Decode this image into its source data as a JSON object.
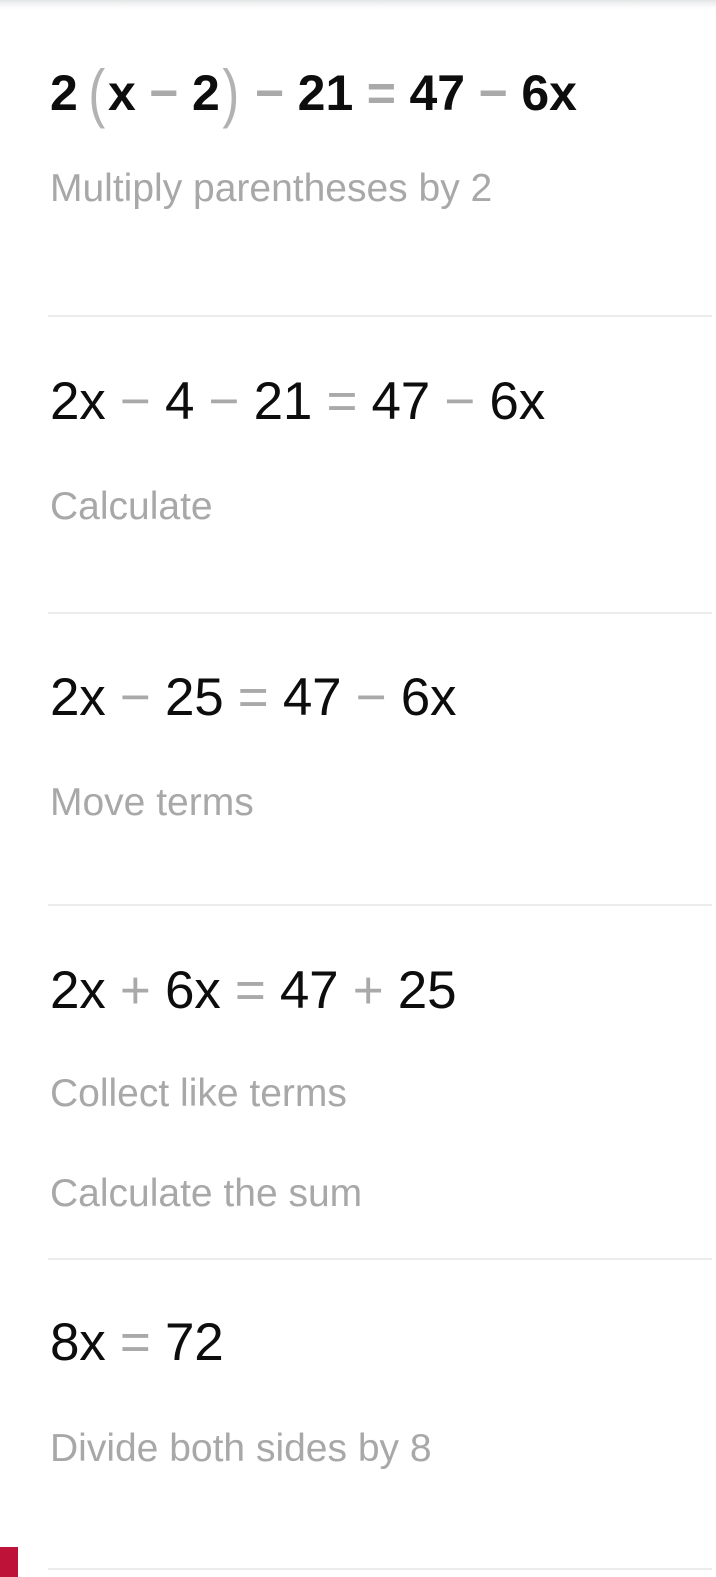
{
  "app": {
    "kind": "math-solver-steps",
    "colors": {
      "text": "#0d0d0d",
      "muted": "#a8a8a8",
      "operator": "#a9a9a9",
      "paren": "#b2b2b2",
      "divider": "#ececec",
      "accent": "#be1238",
      "background": "#ffffff"
    }
  },
  "problem": {
    "original_equation": "2(x − 2) − 21 = 47 − 6x",
    "variable": "x"
  },
  "steps": [
    {
      "index": 1,
      "equation_text": "2(x − 2) − 21 = 47 − 6x",
      "emphasis": "bold",
      "tokens": [
        {
          "t": "2",
          "k": "term"
        },
        {
          "t": "(",
          "k": "paren"
        },
        {
          "t": "x",
          "k": "term"
        },
        {
          "t": "−",
          "k": "op"
        },
        {
          "t": "2",
          "k": "term"
        },
        {
          "t": ")",
          "k": "paren"
        },
        {
          "t": "−",
          "k": "op"
        },
        {
          "t": "21",
          "k": "term"
        },
        {
          "t": "=",
          "k": "op"
        },
        {
          "t": "47",
          "k": "term"
        },
        {
          "t": "−",
          "k": "op"
        },
        {
          "t": "6x",
          "k": "term"
        }
      ],
      "hints": [
        "Multiply parentheses by 2"
      ]
    },
    {
      "index": 2,
      "equation_text": "2x − 4 − 21 = 47 − 6x",
      "emphasis": "regular",
      "tokens": [
        {
          "t": "2x",
          "k": "term"
        },
        {
          "t": "−",
          "k": "op"
        },
        {
          "t": "4",
          "k": "term"
        },
        {
          "t": "−",
          "k": "op"
        },
        {
          "t": "21",
          "k": "term"
        },
        {
          "t": "=",
          "k": "op"
        },
        {
          "t": "47",
          "k": "term"
        },
        {
          "t": "−",
          "k": "op"
        },
        {
          "t": "6x",
          "k": "term"
        }
      ],
      "hints": [
        "Calculate"
      ]
    },
    {
      "index": 3,
      "equation_text": "2x − 25 = 47 − 6x",
      "emphasis": "regular",
      "tokens": [
        {
          "t": "2x",
          "k": "term"
        },
        {
          "t": "−",
          "k": "op"
        },
        {
          "t": "25",
          "k": "term"
        },
        {
          "t": "=",
          "k": "op"
        },
        {
          "t": "47",
          "k": "term"
        },
        {
          "t": "−",
          "k": "op"
        },
        {
          "t": "6x",
          "k": "term"
        }
      ],
      "hints": [
        "Move terms"
      ]
    },
    {
      "index": 4,
      "equation_text": "2x + 6x = 47 + 25",
      "emphasis": "regular",
      "tokens": [
        {
          "t": "2x",
          "k": "term"
        },
        {
          "t": "+",
          "k": "op"
        },
        {
          "t": "6x",
          "k": "term"
        },
        {
          "t": "=",
          "k": "op"
        },
        {
          "t": "47",
          "k": "term"
        },
        {
          "t": "+",
          "k": "op"
        },
        {
          "t": "25",
          "k": "term"
        }
      ],
      "hints": [
        "Collect like terms",
        "Calculate the sum"
      ]
    },
    {
      "index": 5,
      "equation_text": "8x = 72",
      "emphasis": "regular",
      "tokens": [
        {
          "t": "8x",
          "k": "term"
        },
        {
          "t": "=",
          "k": "op"
        },
        {
          "t": "72",
          "k": "term"
        }
      ],
      "hints": [
        "Divide both sides by 8"
      ]
    }
  ]
}
